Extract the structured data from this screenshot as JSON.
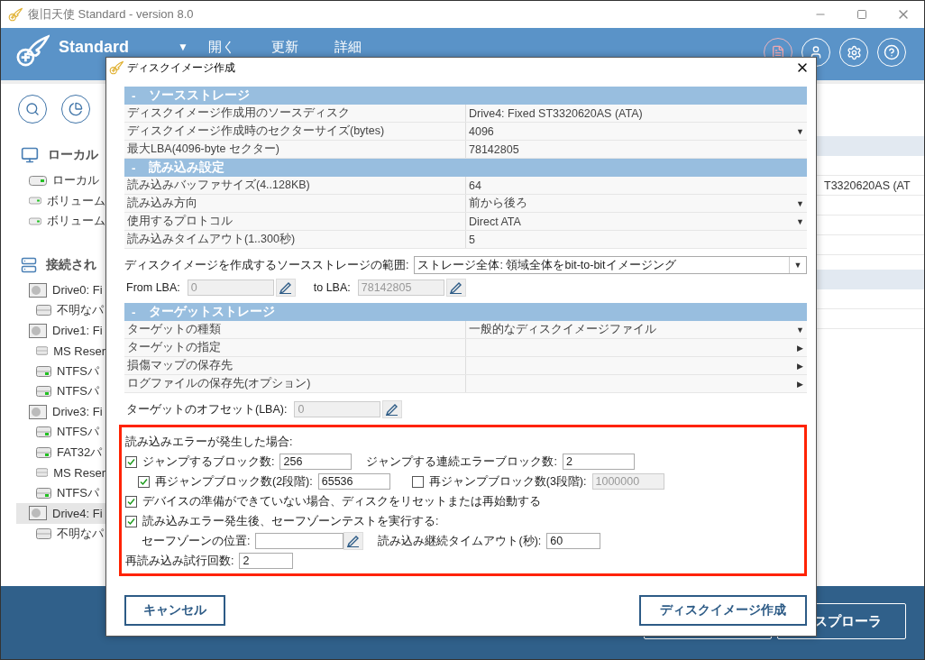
{
  "window": {
    "title": "復旧天使 Standard - version 8.0"
  },
  "header": {
    "product": "Standard",
    "menu_caret": "▼",
    "menu": [
      "開く",
      "更新",
      "詳細"
    ]
  },
  "sidebar": {
    "sections": [
      {
        "kind": "local",
        "title": "ローカル",
        "items": [
          {
            "kind": "volume",
            "label": "ローカル",
            "selected": false
          },
          {
            "kind": "volume",
            "label": "ボリューム",
            "selected": false
          },
          {
            "kind": "volume",
            "label": "ボリューム",
            "selected": false
          }
        ]
      },
      {
        "kind": "connected",
        "title": "接続され",
        "items": [
          {
            "kind": "drive",
            "label": "Drive0: Fi",
            "selected": false,
            "children": [
              {
                "kind": "partition",
                "label": "不明なパ",
                "selected": false
              }
            ]
          },
          {
            "kind": "drive",
            "label": "Drive1: Fi",
            "selected": false,
            "children": [
              {
                "kind": "partition",
                "label": "MS Reser",
                "selected": false
              },
              {
                "kind": "mounted",
                "label": "NTFSパ",
                "selected": false
              },
              {
                "kind": "mounted",
                "label": "NTFSパ",
                "selected": false
              }
            ]
          },
          {
            "kind": "drive",
            "label": "Drive3: Fi",
            "selected": false,
            "children": [
              {
                "kind": "mounted",
                "label": "NTFSパ",
                "selected": false
              },
              {
                "kind": "mounted",
                "label": "FAT32パ",
                "selected": false
              },
              {
                "kind": "partition",
                "label": "MS Reser",
                "selected": false
              },
              {
                "kind": "mounted",
                "label": "NTFSパ",
                "selected": false
              }
            ]
          },
          {
            "kind": "drive",
            "label": "Drive4: Fi",
            "selected": true,
            "children": [
              {
                "kind": "partition",
                "label": "不明なパ",
                "selected": false
              }
            ]
          }
        ]
      }
    ]
  },
  "right_pane": {
    "cell": "T3320620AS (AT"
  },
  "bottom_bar": {
    "button": "スプローラ"
  },
  "dialog": {
    "title": "ディスクイメージ作成",
    "sections": [
      {
        "marker": "-",
        "title": "ソースストレージ",
        "rows": [
          {
            "label": "ディスクイメージ作成用のソースディスク",
            "value": "Drive4: Fixed ST3320620AS (ATA)"
          },
          {
            "label": "ディスクイメージ作成時のセクターサイズ(bytes)",
            "value": "4096",
            "arrow": "▼"
          },
          {
            "label": "最大LBA(4096-byte セクター)",
            "value": "78142805"
          }
        ]
      },
      {
        "marker": "-",
        "title": "読み込み設定",
        "rows": [
          {
            "label": "読み込みバッファサイズ(4..128KB)",
            "value": "64"
          },
          {
            "label": "読み込み方向",
            "value": "前から後ろ",
            "arrow": "▼"
          },
          {
            "label": "使用するプロトコル",
            "value": "Direct ATA",
            "arrow": "▼"
          },
          {
            "label": "読み込みタイムアウト(1..300秒)",
            "value": "5"
          }
        ]
      },
      {
        "marker": "-",
        "title": "ターゲットストレージ",
        "rows": [
          {
            "label": "ターゲットの種類",
            "value": "一般的なディスクイメージファイル",
            "arrow": "▼"
          },
          {
            "label": "ターゲットの指定",
            "arrow": "▶"
          },
          {
            "label": "損傷マップの保存先",
            "arrow": "▶"
          },
          {
            "label": "ログファイルの保存先(オプション)",
            "arrow": "▶"
          }
        ]
      }
    ],
    "range": {
      "label": "ディスクイメージを作成するソースストレージの範囲:",
      "value": "ストレージ全体: 領域全体をbit-to-bitイメージング",
      "arrow": "▼"
    },
    "lba": {
      "from_label": "From LBA:",
      "from_value": "0",
      "to_label": "to LBA:",
      "to_value": "78142805",
      "disabled": true
    },
    "offset": {
      "label": "ターゲットのオフセット(LBA):",
      "value": "0",
      "disabled": true
    },
    "error_handling": {
      "highlighted": true,
      "title": "読み込みエラーが発生した場合:",
      "jump": {
        "checked": true,
        "label": "ジャンプするブロック数:",
        "value": "256"
      },
      "consecutive": {
        "label": "ジャンプする連続エラーブロック数:",
        "value": "2"
      },
      "rejump2": {
        "checked": true,
        "label": "再ジャンプブロック数(2段階):",
        "value": "65536",
        "disabled": false
      },
      "rejump3": {
        "checked": false,
        "label": "再ジャンプブロック数(3段階):",
        "value": "1000000",
        "disabled": true
      },
      "reset": {
        "checked": true,
        "label": "デバイスの準備ができていない場合、ディスクをリセットまたは再始動する"
      },
      "safezone": {
        "checked": true,
        "label": "読み込みエラー発生後、セーフゾーンテストを実行する:"
      },
      "safezone_position": {
        "label": "セーフゾーンの位置:"
      },
      "timeout": {
        "label": "読み込み継続タイムアウト(秒):",
        "value": "60"
      },
      "retries": {
        "label": "再読み込み試行回数:",
        "value": "2"
      }
    },
    "buttons": [
      {
        "label": "キャンセル"
      },
      {
        "label": "ディスクイメージ作成"
      }
    ]
  }
}
